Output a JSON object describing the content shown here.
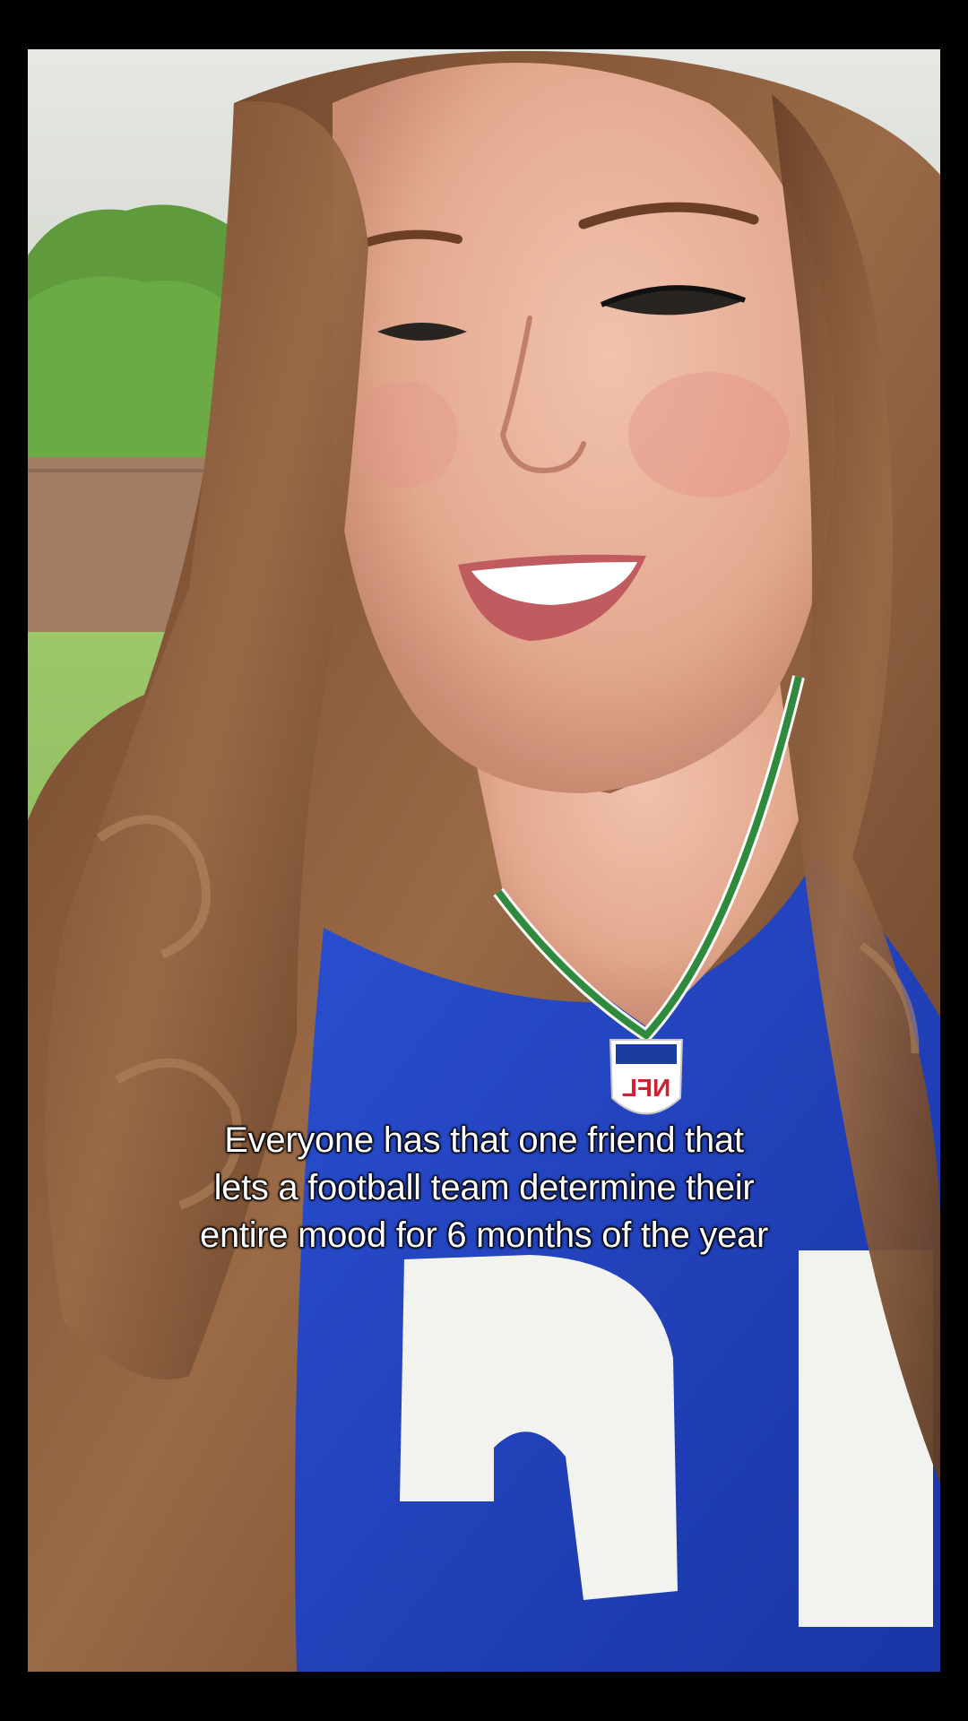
{
  "caption": {
    "lines": [
      "Everyone has that one friend that",
      "lets a football team determine their",
      "entire mood for 6 months of the year"
    ]
  },
  "colors": {
    "letterbox": "#000000",
    "jersey_blue": "#1f3fb8",
    "jersey_number": "#f2f2ee",
    "hair": "#8a5a3c",
    "skin": "#e9b49e",
    "trim_green": "#2f8a3e",
    "grass": "#8fbf5a",
    "trees": "#5f9a3c",
    "fence": "#a07a62",
    "sky": "#e4e6e2"
  },
  "scene": {
    "jersey_crest_text": "NFL",
    "jersey_number_text": "15"
  }
}
